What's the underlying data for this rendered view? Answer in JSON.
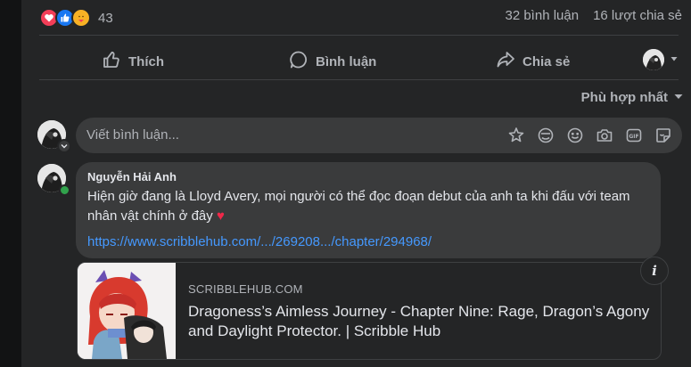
{
  "reactions": {
    "icons": [
      "love-icon",
      "like-icon",
      "care-icon"
    ],
    "count": "43",
    "comments": "32 bình luận",
    "shares": "16 lượt chia sẻ"
  },
  "actions": {
    "like": "Thích",
    "comment": "Bình luận",
    "share": "Chia sẻ"
  },
  "sort": {
    "label": "Phù hợp nhất"
  },
  "composer": {
    "placeholder": "Viết bình luận...",
    "icons": [
      "sticker-icon",
      "avatar-sticker-icon",
      "emoji-icon",
      "camera-icon",
      "gif-icon",
      "sticker-smile-icon"
    ]
  },
  "comment": {
    "author": "Nguyễn Hải Anh",
    "text": "Hiện giờ đang là Lloyd Avery, mọi người có thể đọc đoạn debut của anh ta khi đấu với team nhân vật chính ở đây",
    "emoji": "♥",
    "link": "https://www.scribblehub.com/.../269208.../chapter/294968/"
  },
  "preview": {
    "domain": "SCRIBBLEHUB.COM",
    "title": "Dragoness’s Aimless Journey - Chapter Nine: Rage, Dragon’s Agony and Daylight Protector. | Scribble Hub",
    "info": "i"
  },
  "colors": {
    "background": "#242526",
    "bubble": "#3a3b3c",
    "text": "#e4e6eb",
    "secondary": "#b0b3b8",
    "link": "#4599ff",
    "online": "#31a24c"
  }
}
